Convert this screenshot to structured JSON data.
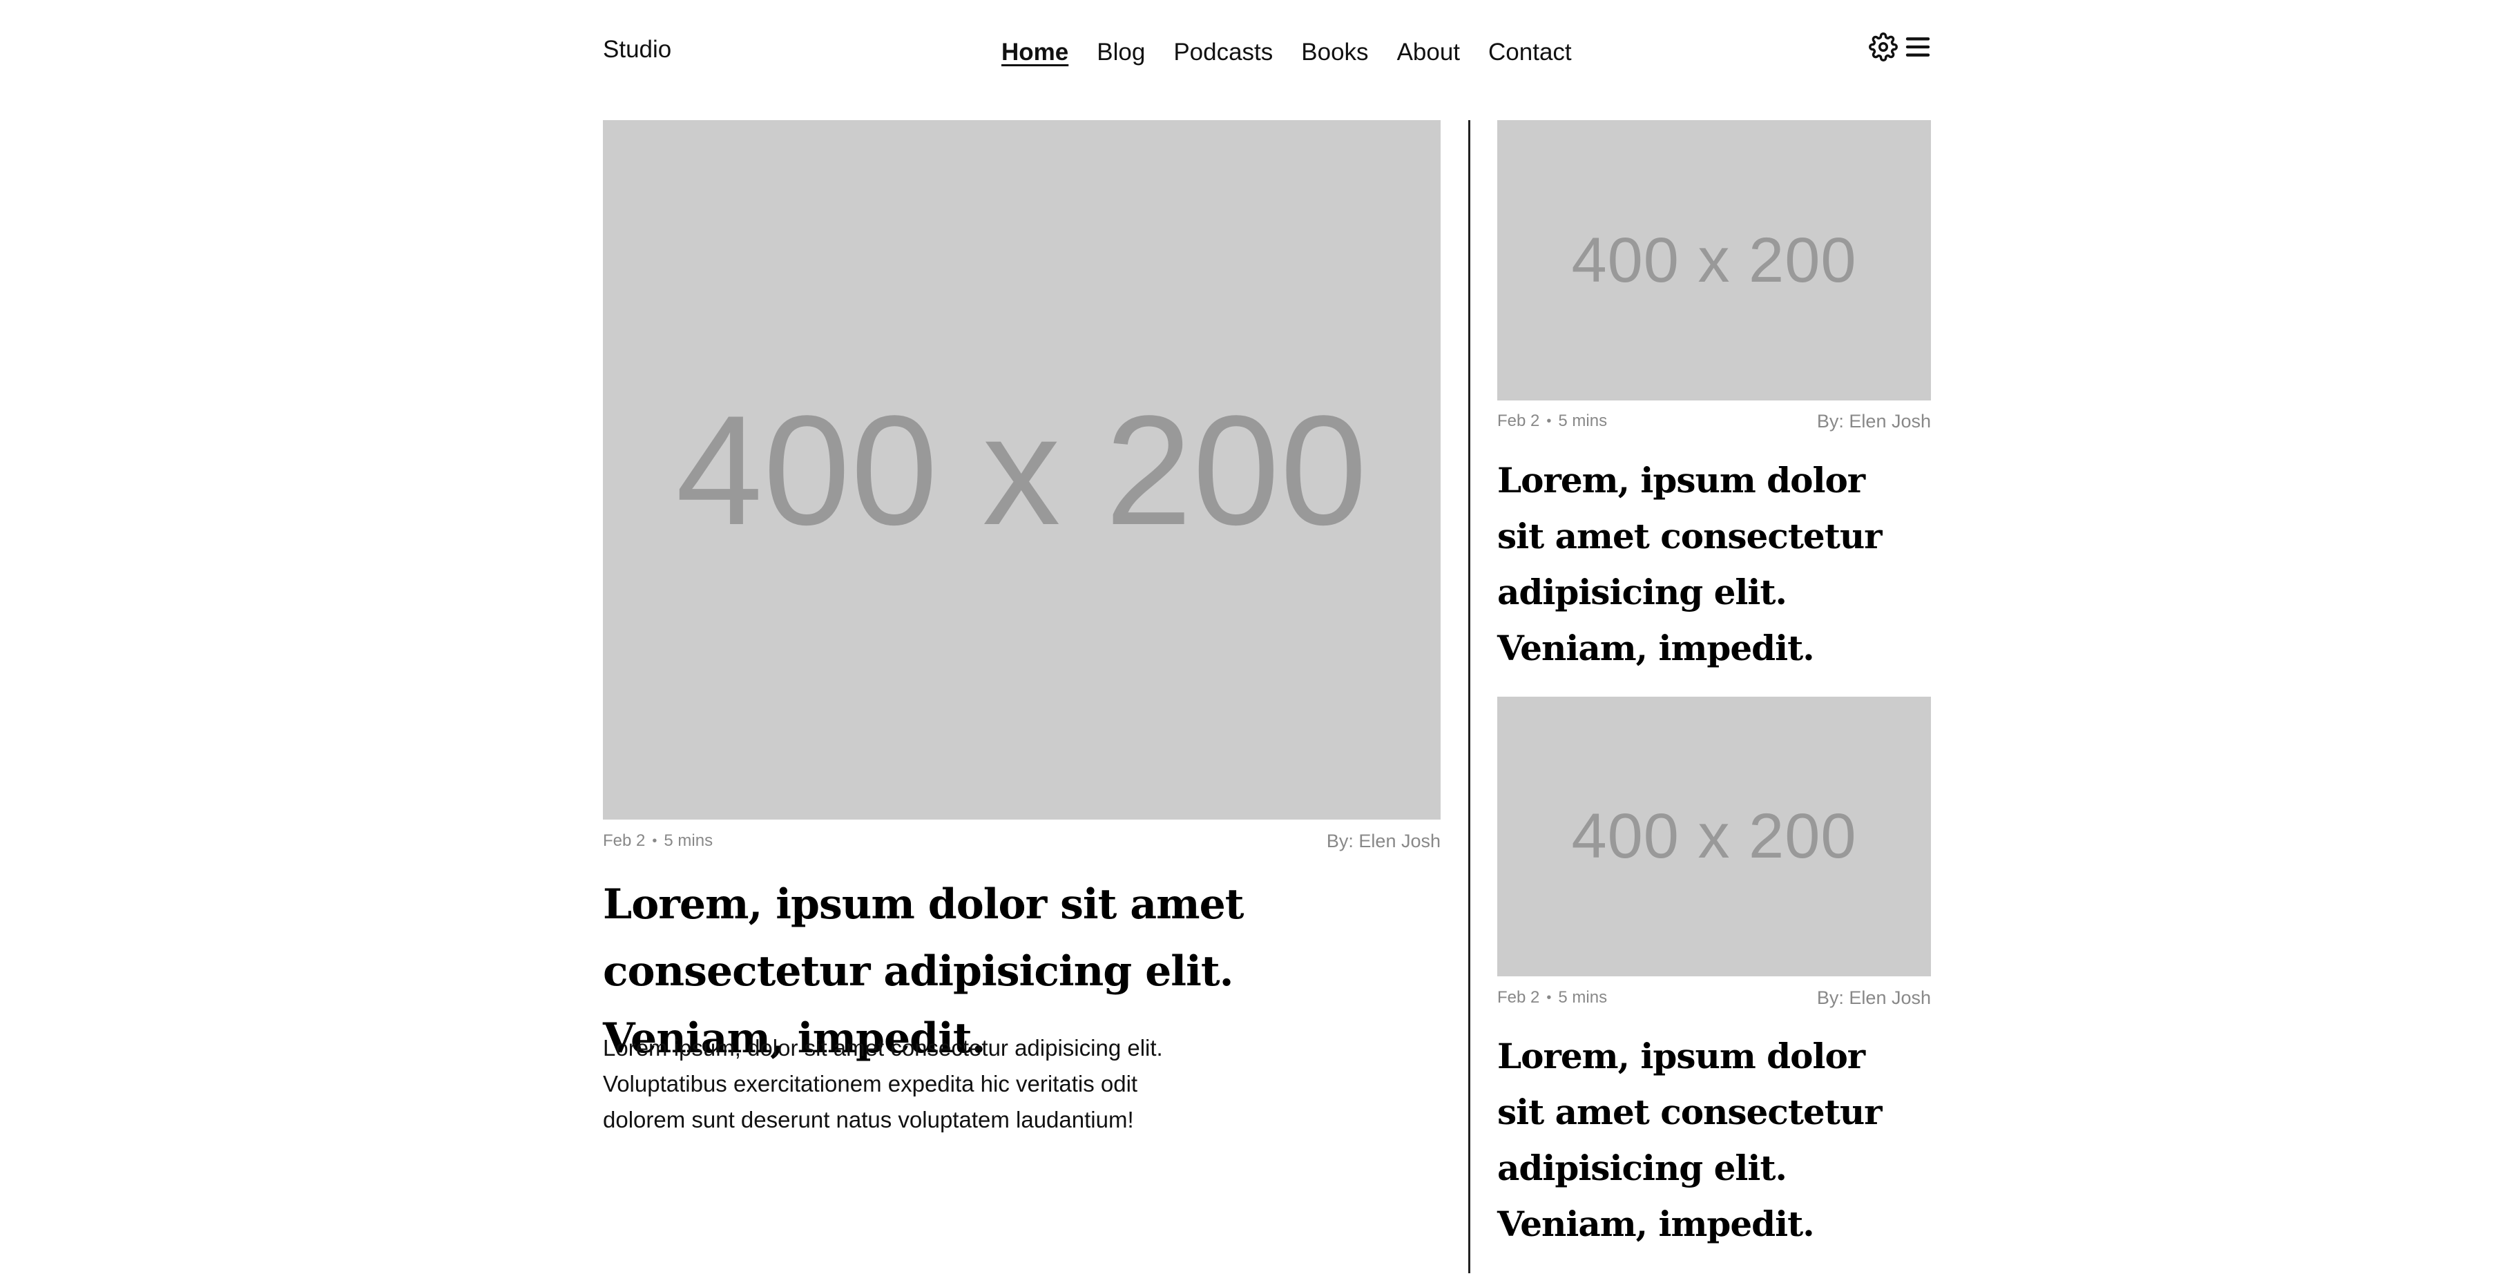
{
  "header": {
    "brand": "Studio",
    "nav": [
      {
        "label": "Home",
        "active": true
      },
      {
        "label": "Blog",
        "active": false
      },
      {
        "label": "Podcasts",
        "active": false
      },
      {
        "label": "Books",
        "active": false
      },
      {
        "label": "About",
        "active": false
      },
      {
        "label": "Contact",
        "active": false
      }
    ],
    "icons": [
      "gear-icon",
      "menu-icon"
    ]
  },
  "featured": {
    "image_text": "400 x 200",
    "date": "Feb 2",
    "separator": "•",
    "read_time": "5 mins",
    "author": "By: Elen Josh",
    "title": "Lorem, ipsum dolor sit amet consectetur adipisicing elit. Veniam, impedit.",
    "excerpt": "Lorem ipsum, dolor sit amet consectetur adipisicing elit. Voluptatibus exercitationem expedita hic veritatis odit dolorem sunt deserunt natus voluptatem laudantium!"
  },
  "sidebar_posts": [
    {
      "image_text": "400 x 200",
      "date": "Feb 2",
      "separator": "•",
      "read_time": "5 mins",
      "author": "By: Elen Josh",
      "title": "Lorem, ipsum dolor sit amet consectetur adipisicing elit. Veniam, impedit."
    },
    {
      "image_text": "400 x 200",
      "date": "Feb 2",
      "separator": "•",
      "read_time": "5 mins",
      "author": "By: Elen Josh",
      "title": "Lorem, ipsum dolor sit amet consectetur adipisicing elit. Veniam, impedit."
    }
  ],
  "colors": {
    "placeholder_bg": "#cccccc",
    "placeholder_text": "#999999",
    "meta_text": "#888888",
    "divider": "#222222"
  }
}
